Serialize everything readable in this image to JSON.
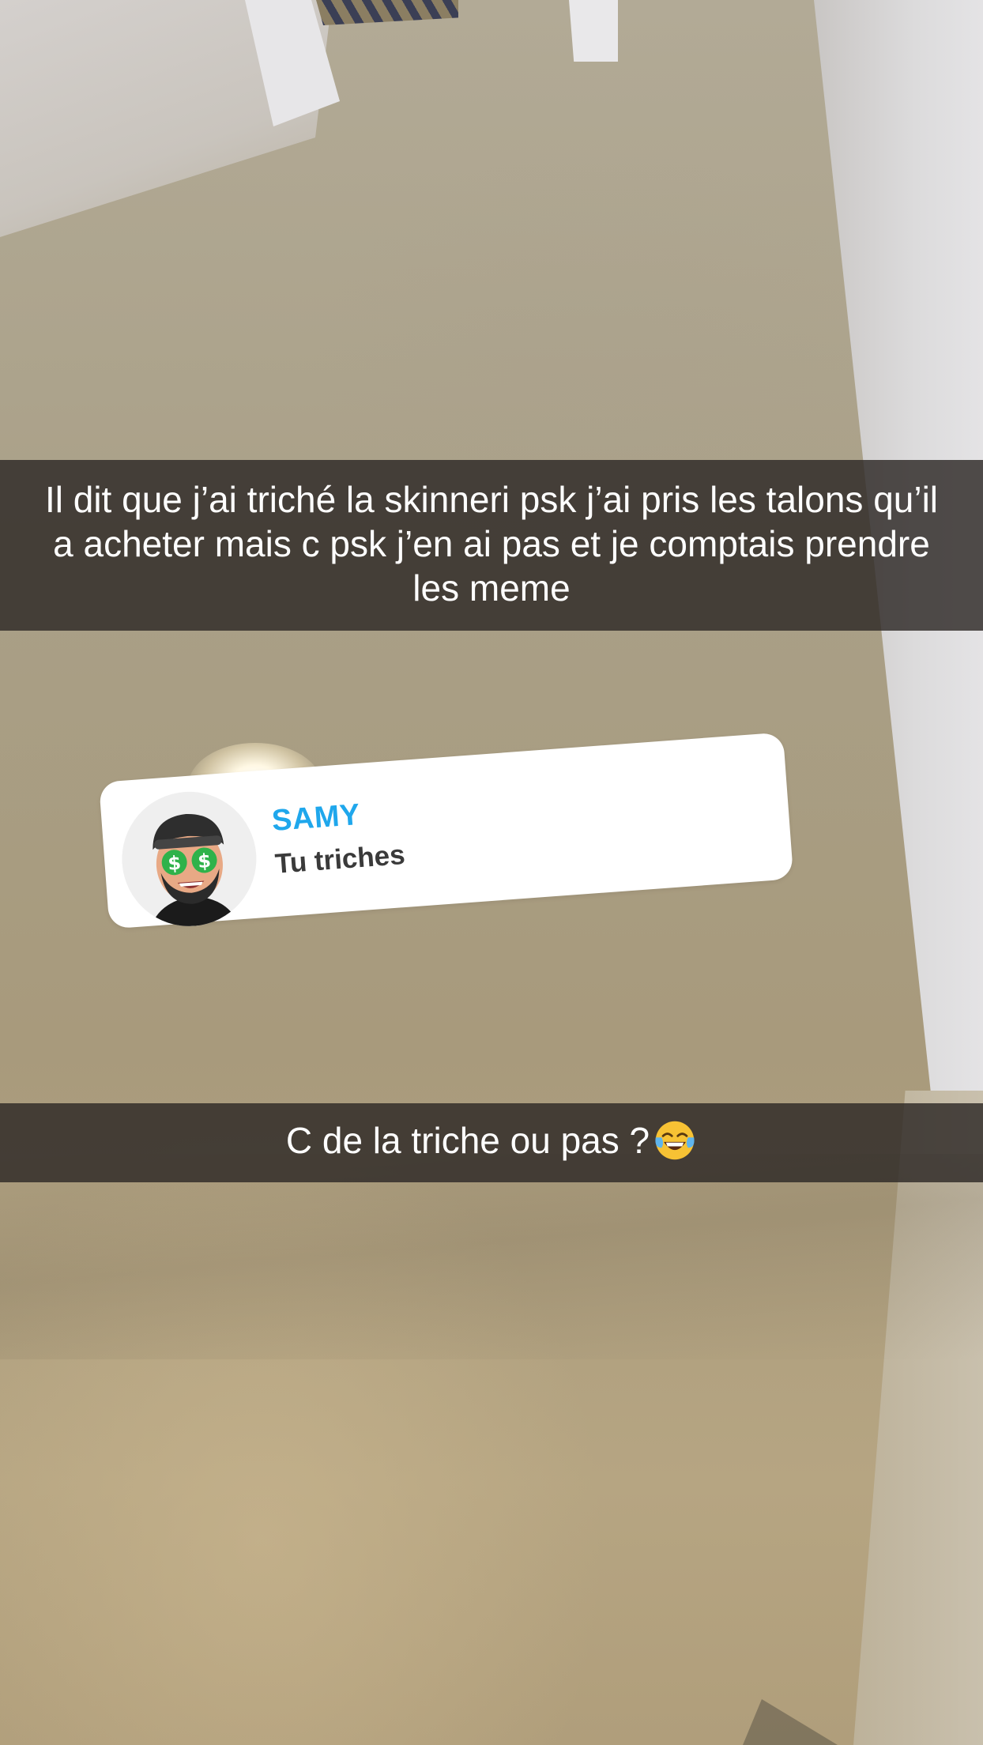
{
  "story": {
    "caption_top": "Il dit que j’ai triché la skinneri psk j’ai pris les talons qu’il a acheter mais c psk j’en ai pas et je comptais prendre les meme",
    "caption_bottom": "C de la triche ou pas ?",
    "caption_bottom_emoji": "face-with-tears-of-joy-icon"
  },
  "reply": {
    "name": "SAMY",
    "message": "Tu triches",
    "avatar_icon": "bitmoji-dollar-eyes-avatar",
    "name_color": "#1fa7ec"
  },
  "colors": {
    "caption_background": "#2d2826",
    "caption_text": "#ffffff"
  }
}
